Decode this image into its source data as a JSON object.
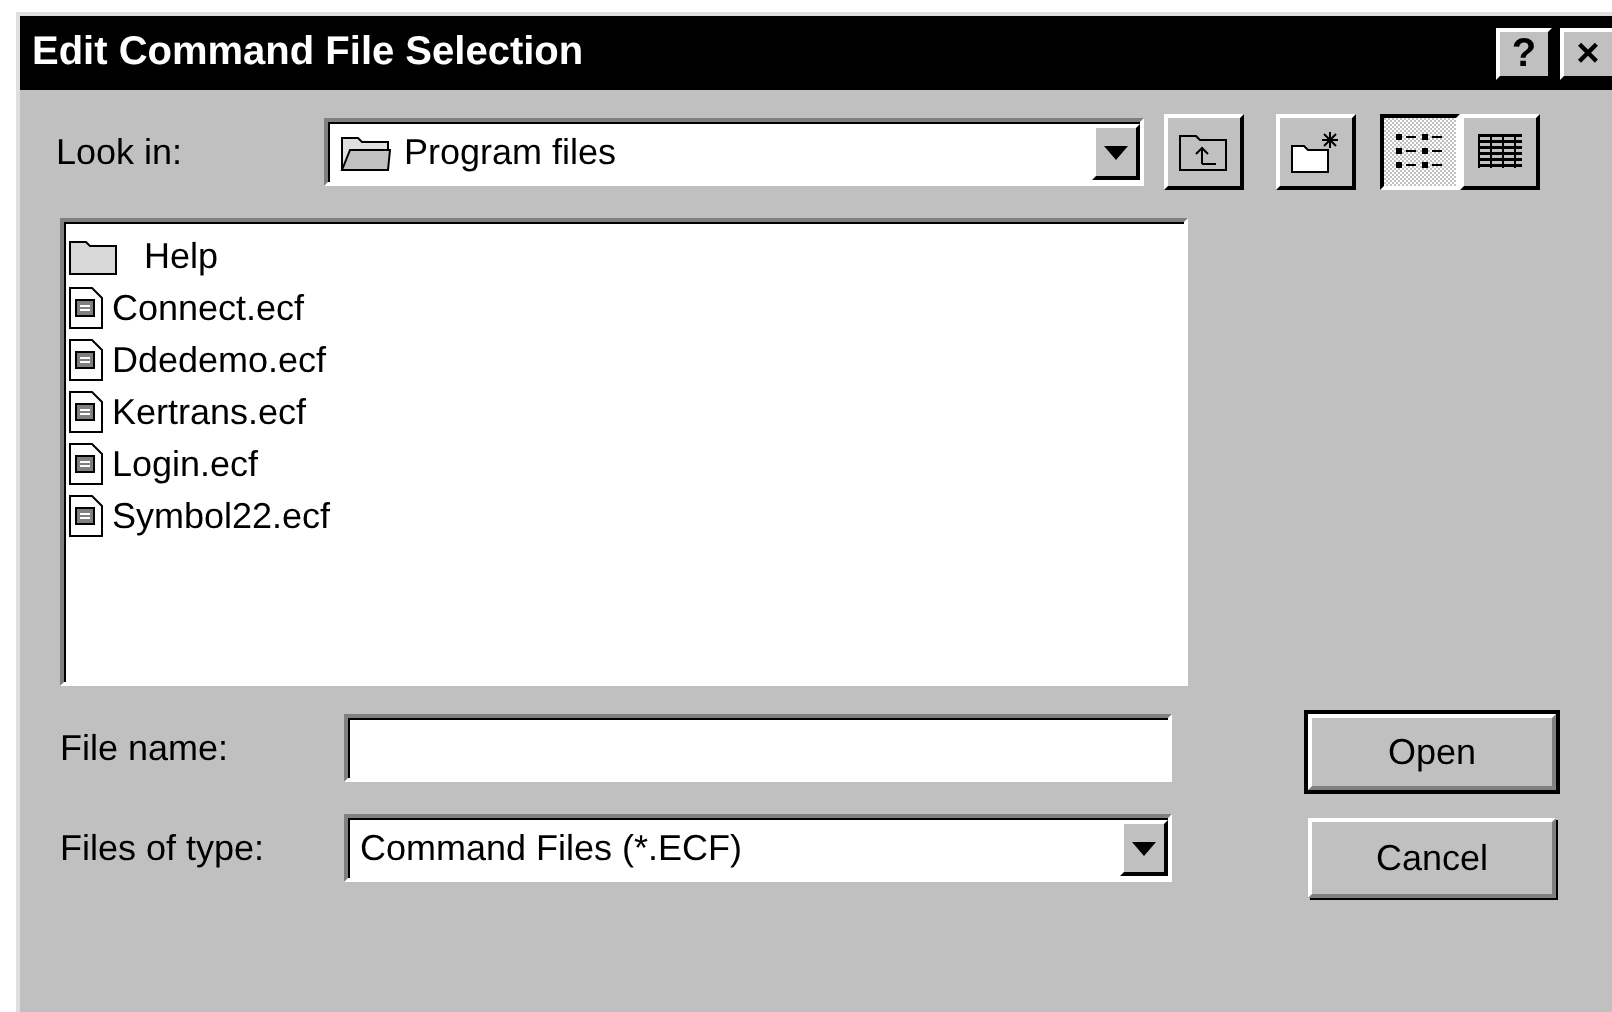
{
  "window": {
    "title": "Edit Command File Selection",
    "help_button": "?",
    "close_button": "×"
  },
  "look_in": {
    "label": "Look in:",
    "value": "Program files"
  },
  "view_buttons": [
    {
      "kind": "list",
      "selected": true
    },
    {
      "kind": "details",
      "selected": false
    }
  ],
  "files": [
    {
      "kind": "folder",
      "name": "Help"
    },
    {
      "kind": "file",
      "name": "Connect.ecf"
    },
    {
      "kind": "file",
      "name": "Ddedemo.ecf"
    },
    {
      "kind": "file",
      "name": "Kertrans.ecf"
    },
    {
      "kind": "file",
      "name": "Login.ecf"
    },
    {
      "kind": "file",
      "name": "Symbol22.ecf"
    }
  ],
  "file_name": {
    "label": "File name:"
  },
  "file_type": {
    "label": "Files of type:",
    "value": "Command Files (*.ECF)"
  },
  "buttons": [
    {
      "label": "Open",
      "default": true
    },
    {
      "label": "Cancel",
      "default": false
    }
  ]
}
